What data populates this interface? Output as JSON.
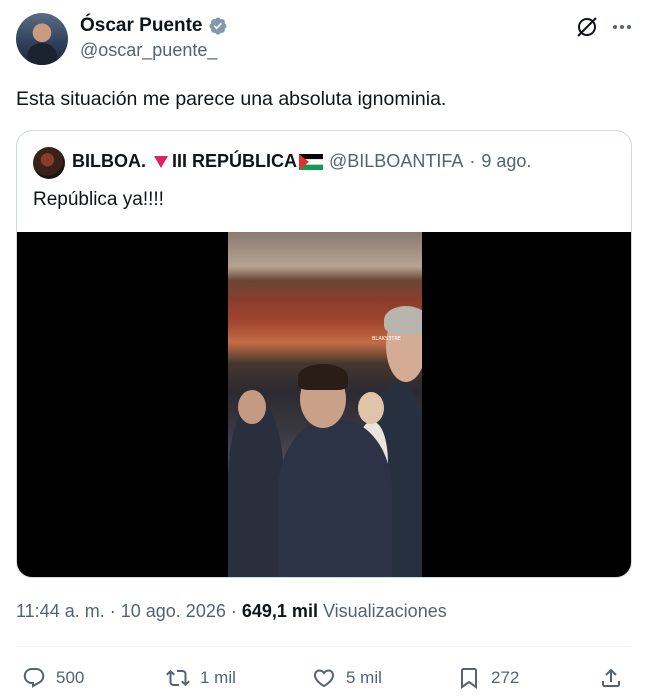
{
  "author": {
    "display_name": "Óscar Puente",
    "handle": "@oscar_puente_",
    "verified": true,
    "avatar_icon": "profile-photo"
  },
  "tweet": {
    "text": "Esta situación me parece una absoluta ignominia."
  },
  "quoted": {
    "display_name_part1": "BILBOA.",
    "display_name_part2": "III REPÚBLICA",
    "handle": "@BILBOANTIFA",
    "separator": "·",
    "date": "9 ago.",
    "text": "República ya!!!!",
    "video_watermark": "BLAKS3TRE"
  },
  "meta": {
    "time": "11:44 a. m.",
    "separator": "·",
    "date": "10 ago. 2026",
    "separator2": "·",
    "views_count": "649,1 mil",
    "views_label": "Visualizaciones"
  },
  "actions": {
    "replies": "500",
    "reposts": "1 mil",
    "likes": "5 mil",
    "bookmarks": "272"
  },
  "colors": {
    "text_primary": "#0f1419",
    "text_secondary": "#536471",
    "border": "#cfd9de",
    "verified_badge": "#829aab"
  }
}
